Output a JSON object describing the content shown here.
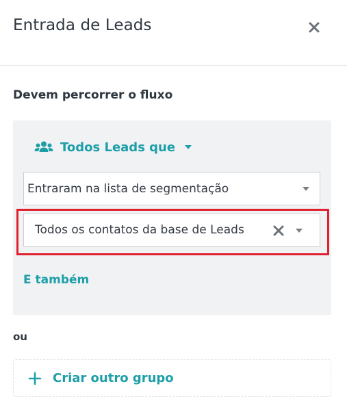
{
  "header": {
    "title": "Entrada de Leads",
    "close_icon": "close-icon"
  },
  "section": {
    "label": "Devem percorrer o fluxo"
  },
  "group": {
    "header_label": "Todos Leads que",
    "header_icon": "people-icon",
    "condition_select": {
      "value": "Entraram na lista de segmentação"
    },
    "list_select": {
      "value": "Todos os contatos da base de Leads",
      "highlighted": true
    },
    "and_also_label": "E também"
  },
  "separator_label": "ou",
  "new_group": {
    "label": "Criar outro grupo",
    "icon": "plus-icon"
  },
  "colors": {
    "accent": "#1d9fa8",
    "highlight": "#e0202e",
    "group_bg": "#f1f2f4",
    "text": "#2f3740"
  }
}
